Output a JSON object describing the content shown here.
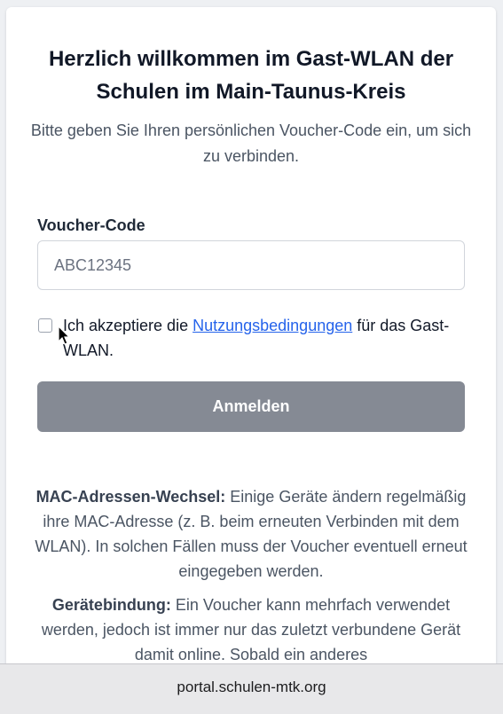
{
  "page": {
    "title": "Herzlich willkommen im Gast-WLAN der Schulen im Main-Taunus-Kreis",
    "subtitle": "Bitte geben Sie Ihren persönlichen Voucher-Code ein, um sich zu verbinden."
  },
  "form": {
    "voucher_label": "Voucher-Code",
    "voucher_placeholder": "ABC12345",
    "voucher_value": "",
    "terms_prefix": "Ich akzeptiere die ",
    "terms_link": "Nutzungsbedingungen",
    "terms_suffix": " für das Gast-WLAN.",
    "terms_checked": false,
    "submit_label": "Anmelden",
    "submit_color": "#858a94",
    "link_color": "#2563eb"
  },
  "info": {
    "mac_heading": "MAC-Adressen-Wechsel:",
    "mac_text": " Einige Geräte ändern regelmäßig ihre MAC-Adresse (z. B. beim erneuten Verbinden mit dem WLAN). In solchen Fällen muss der Voucher eventuell erneut eingegeben werden.",
    "device_heading": "Gerätebindung:",
    "device_text": " Ein Voucher kann mehrfach verwendet werden, jedoch ist immer nur das zuletzt verbundene Gerät damit online. Sobald ein anderes"
  },
  "browser": {
    "url": "portal.schulen-mtk.org"
  },
  "icons": {
    "cursor": "mouse-pointer-icon"
  }
}
